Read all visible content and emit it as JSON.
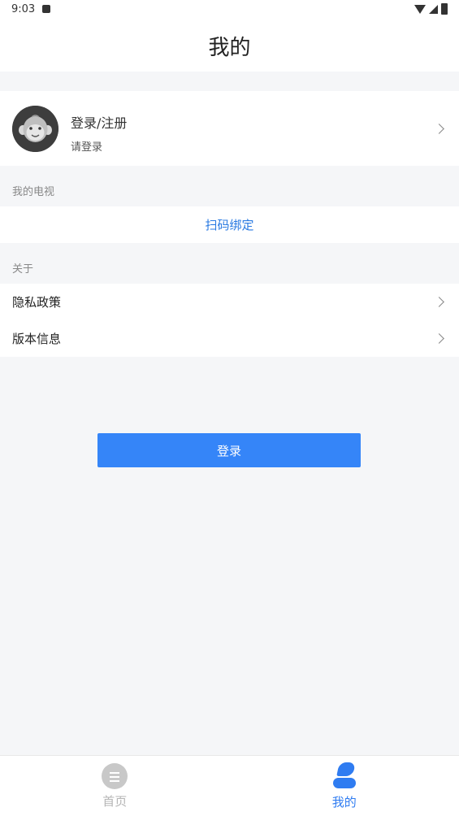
{
  "status_bar": {
    "time": "9:03"
  },
  "header": {
    "title": "我的"
  },
  "profile": {
    "title": "登录/注册",
    "subtitle": "请登录"
  },
  "sections": {
    "tv": {
      "header": "我的电视",
      "action": "扫码绑定"
    },
    "about": {
      "header": "关于",
      "items": [
        {
          "label": "隐私政策"
        },
        {
          "label": "版本信息"
        }
      ]
    }
  },
  "login_button": "登录",
  "tabbar": {
    "tabs": [
      {
        "label": "首页",
        "icon": "home-icon",
        "active": false
      },
      {
        "label": "我的",
        "icon": "person-icon",
        "active": true
      }
    ]
  },
  "colors": {
    "accent": "#3585f8",
    "link": "#2a7ae2",
    "background": "#f5f6f8"
  }
}
